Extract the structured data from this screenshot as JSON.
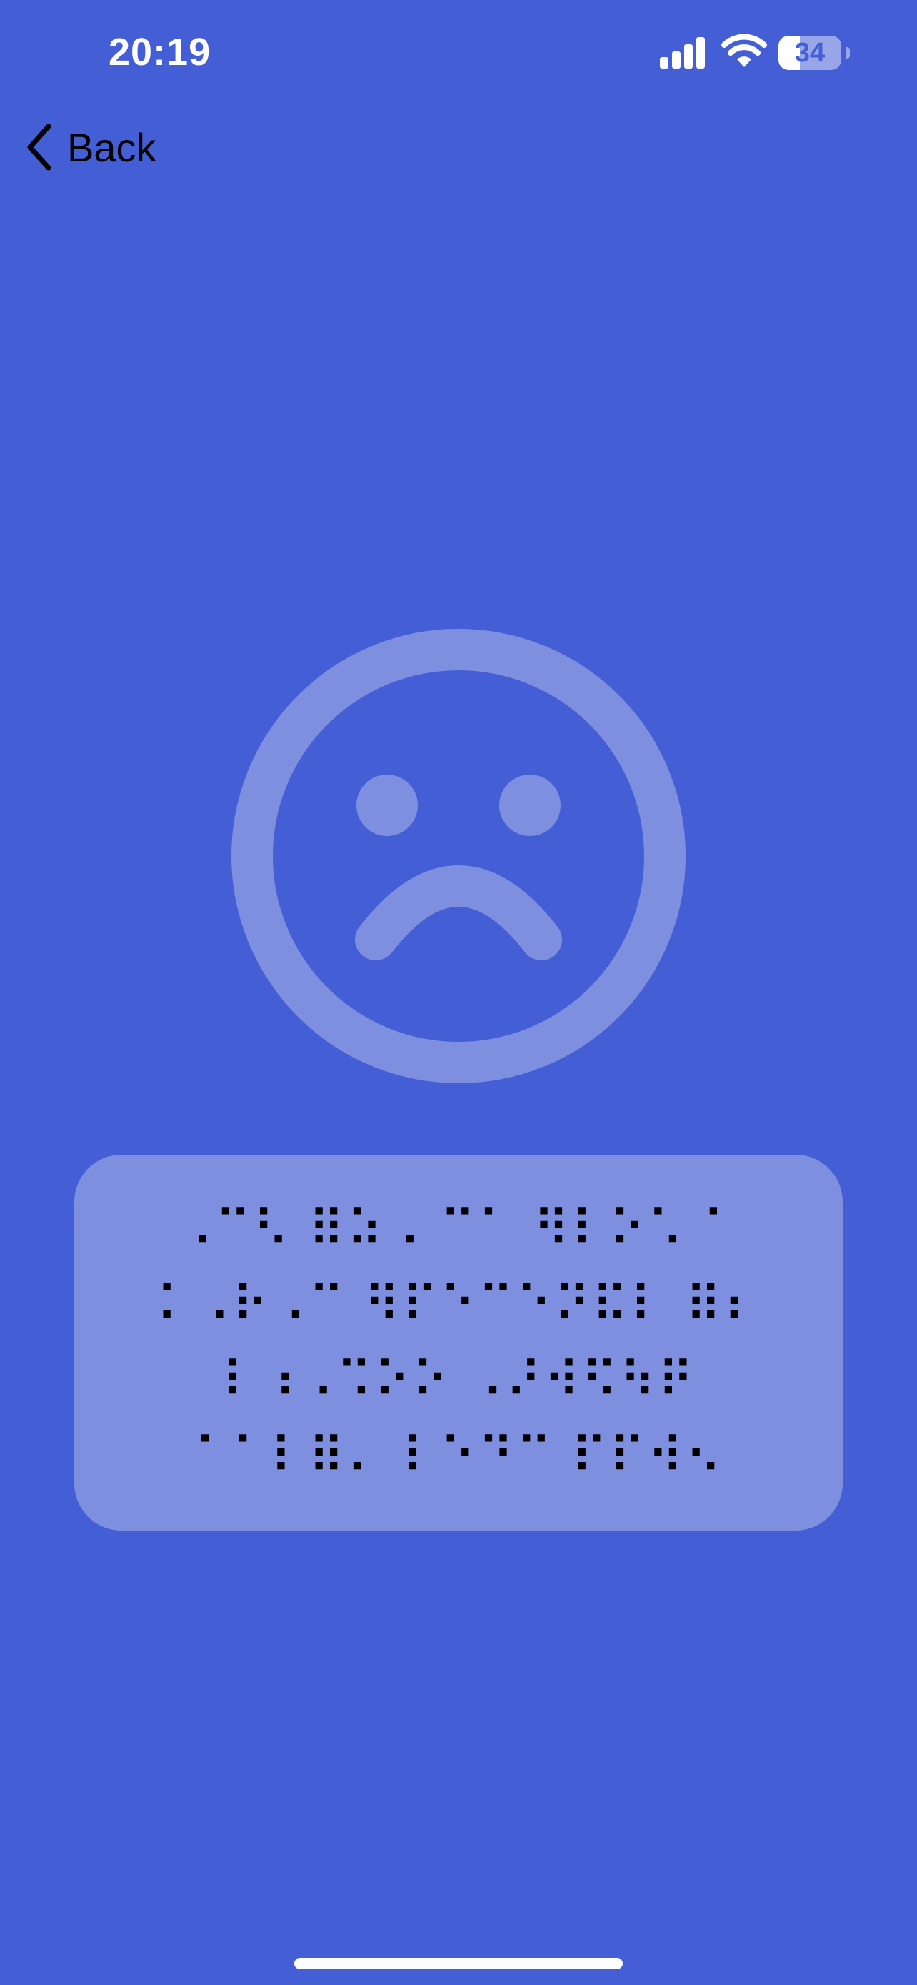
{
  "status_bar": {
    "time": "20:19",
    "battery_level": "34",
    "battery_fraction": 0.34
  },
  "navigation": {
    "back_label": "Back"
  },
  "illustration": {
    "icon": "sad-face-icon",
    "color": "#7E8FE0"
  },
  "braille_message": {
    "lines": [
      "⠠⠉⠣ ⠿⠵⠠ ⠉⠁ ⠻⠇⠕⠡ ⠁",
      "⠅⠠⠗⠠⠉ ⠻⠏⠑⠉⠑⠝⠯⠇ ⠿⠆",
      "⠇⠰⠠⠩⠕⠕ ⠠⠜⠺⠫⠳⠟",
      "⠁⠁⠇⠿⠄ ⠇⠑⠙⠉ ⠏⠏⠺⠢"
    ]
  },
  "colors": {
    "background": "#445ED5",
    "card": "#7E8FE0",
    "text": "#000000"
  }
}
